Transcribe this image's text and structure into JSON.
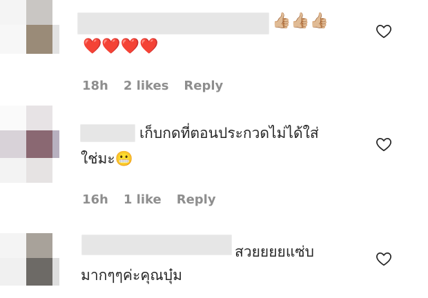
{
  "comments": [
    {
      "emojis_line1": "👍🏼👍🏼👍🏼",
      "emojis_line2": "❤️❤️❤️❤️",
      "time": "18h",
      "likes": "2 likes",
      "reply": "Reply"
    },
    {
      "text_line1": "เก็บกดที่ตอนประกวดไม่ได้ใส่",
      "text_line2": "ใช่มะ😬",
      "time": "16h",
      "likes": "1 like",
      "reply": "Reply"
    },
    {
      "text_line1": "สวยยยยแซ่บ",
      "text_line2": "มากๆๆค่ะคุณบุ๋ม"
    }
  ],
  "icons": {
    "like": "heart-outline-icon"
  },
  "colors": {
    "meta": "#8e8e8e",
    "text": "#262626",
    "blur": "#e6e6e6"
  }
}
